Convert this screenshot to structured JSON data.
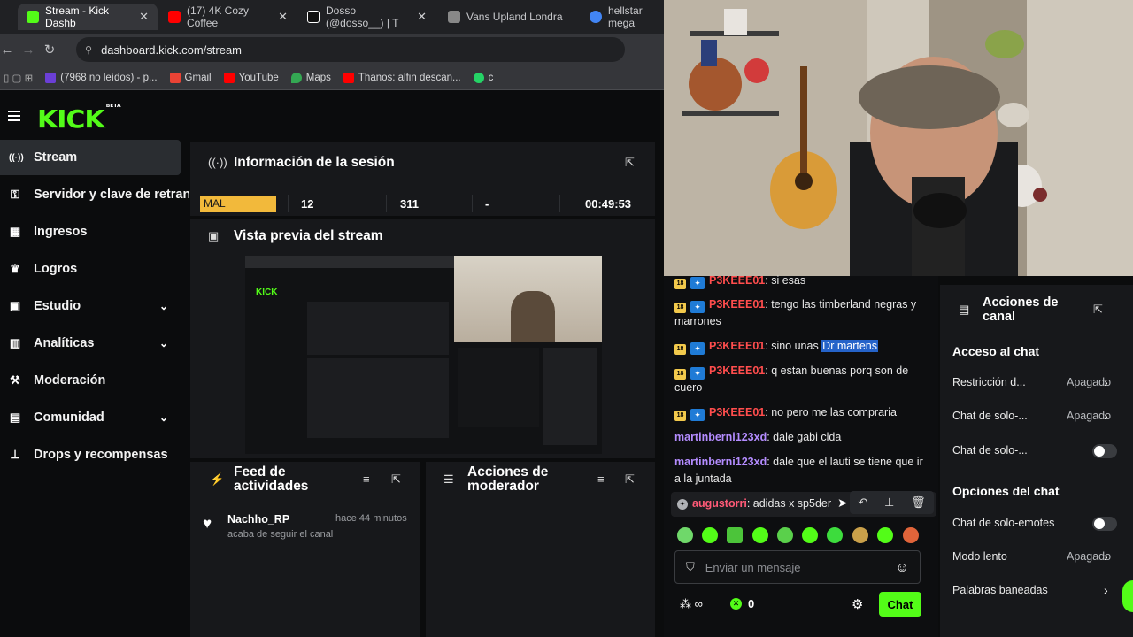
{
  "browser": {
    "tabs": [
      {
        "title": "Stream - Kick Dashb",
        "favicon_color": "#53fc18",
        "active": true
      },
      {
        "title": "(17) 4K Cozy Coffee",
        "favicon_color": "#ff0000",
        "active": false
      },
      {
        "title": "Dosso (@dosso__) | T",
        "favicon_color": "#111111",
        "active": false
      },
      {
        "title": "Vans Upland Londra",
        "favicon_color": "#888888",
        "active": false
      },
      {
        "title": "hellstar mega",
        "favicon_color": "#4285f4",
        "active": false
      }
    ],
    "url": "dashboard.kick.com/stream",
    "bookmarks": [
      {
        "label": "(7968 no leídos) - p...",
        "color": "#6b3fd6"
      },
      {
        "label": "Gmail",
        "color": "#ea4335"
      },
      {
        "label": "YouTube",
        "color": "#ff0000"
      },
      {
        "label": "Maps",
        "color": "#34a853"
      },
      {
        "label": "Thanos: alfin descan...",
        "color": "#ff0000"
      },
      {
        "label": "c",
        "color": "#25d366"
      }
    ]
  },
  "kick": {
    "logo": "KICK",
    "logo_badge": "BETA",
    "accent": "#53fc18",
    "sidebar": [
      {
        "label": "Stream",
        "icon": "broadcast-icon",
        "glyph": "((·))",
        "selected": true,
        "expandable": false
      },
      {
        "label": "Servidor y clave de retransmisión",
        "icon": "key-icon",
        "glyph": "🔑",
        "selected": false,
        "expandable": false
      },
      {
        "label": "Ingresos",
        "icon": "chart-icon",
        "glyph": "▦",
        "selected": false,
        "expandable": false
      },
      {
        "label": "Logros",
        "icon": "trophy-icon",
        "glyph": "🏆",
        "selected": false,
        "expandable": false
      },
      {
        "label": "Estudio",
        "icon": "studio-icon",
        "glyph": "▣",
        "selected": false,
        "expandable": true
      },
      {
        "label": "Analíticas",
        "icon": "analytics-icon",
        "glyph": "▥",
        "selected": false,
        "expandable": true
      },
      {
        "label": "Moderación",
        "icon": "wrench-icon",
        "glyph": "🔧",
        "selected": false,
        "expandable": false
      },
      {
        "label": "Comunidad",
        "icon": "community-icon",
        "glyph": "▤",
        "selected": false,
        "expandable": true
      },
      {
        "label": "Drops y recompensas",
        "icon": "drops-icon",
        "glyph": "⊥",
        "selected": false,
        "expandable": false
      }
    ],
    "session": {
      "title": "Información de la sesión",
      "stats": [
        "MAL",
        "12",
        "311",
        "-",
        "00:49:53"
      ],
      "status_color": "#f2b93b"
    },
    "preview": {
      "title": "Vista previa del stream"
    },
    "activity": {
      "title": "Feed de actividades",
      "items": [
        {
          "user": "Nachho_RP",
          "text": "acaba de seguir el canal",
          "time": "hace 44 minutos"
        }
      ]
    },
    "mod_actions": {
      "title": "Acciones de moderador"
    }
  },
  "chat": {
    "messages": [
      {
        "user": "P3KEEE01",
        "text": "si esas",
        "badges": true,
        "color": "red"
      },
      {
        "user": "P3KEEE01",
        "text": "tengo las timberland negras y marrones",
        "badges": true,
        "color": "red"
      },
      {
        "user": "P3KEEE01",
        "text": "sino unas ",
        "highlight": "Dr martens",
        "badges": true,
        "color": "red"
      },
      {
        "user": "P3KEEE01",
        "text": "q estan buenas porq son de cuero",
        "badges": true,
        "color": "red"
      },
      {
        "user": "P3KEEE01",
        "text": "no pero me las compraria",
        "badges": true,
        "color": "red"
      },
      {
        "user": "martinberni123xd",
        "text": "dale gabi clda",
        "badges": false,
        "color": "purple"
      },
      {
        "user": "martinberni123xd",
        "text": "dale que el lauti se tiene que ir a la juntada",
        "badges": false,
        "color": "purple"
      },
      {
        "user": "augustorri",
        "text": "adidas x sp5der",
        "badges": false,
        "color": "pink"
      }
    ],
    "sub_badge": "18",
    "input_placeholder": "Enviar un mensaje",
    "points": "0",
    "send_label": "Chat"
  },
  "channel_actions": {
    "title": "Acciones de canal",
    "chat_access_header": "Acceso al chat",
    "chat_options_header": "Opciones del chat",
    "rows": [
      {
        "label": "Restricción d...",
        "value": "Apagado",
        "type": "select"
      },
      {
        "label": "Chat de solo-...",
        "value": "Apagado",
        "type": "select"
      },
      {
        "label": "Chat de solo-...",
        "value": "",
        "type": "toggle"
      },
      {
        "label": "Chat de solo-emotes",
        "value": "",
        "type": "toggle"
      },
      {
        "label": "Modo lento",
        "value": "Apagado",
        "type": "select"
      },
      {
        "label": "Palabras baneadas",
        "value": "",
        "type": "link"
      }
    ]
  }
}
